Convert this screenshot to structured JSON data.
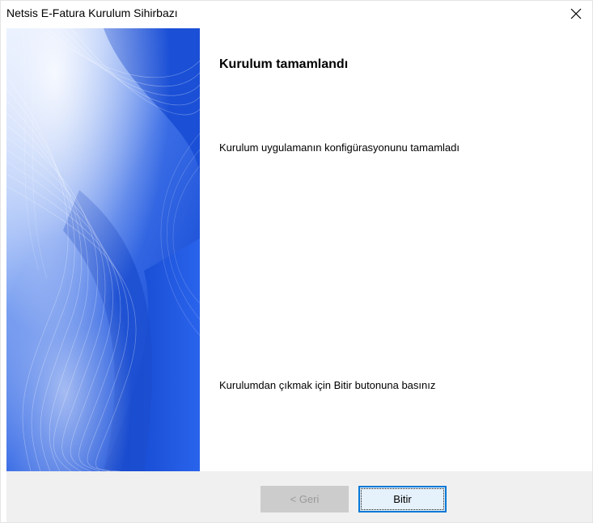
{
  "window": {
    "title": "Netsis E-Fatura Kurulum Sihirbazı",
    "close_icon": "close-icon"
  },
  "banner": {
    "image": "blue-wave-banner"
  },
  "content": {
    "heading": "Kurulum tamamlandı",
    "description": "Kurulum uygulamanın konfigürasyonunu tamamladı",
    "exit_instruction": "Kurulumdan çıkmak için Bitir butonuna basınız"
  },
  "footer": {
    "back_label": "< Geri",
    "back_enabled": false,
    "finish_label": "Bitir",
    "finish_default": true
  },
  "colors": {
    "banner_blue": "#1f5fe0",
    "footer_bg": "#f0f0f0",
    "default_button_border": "#0078d7"
  }
}
